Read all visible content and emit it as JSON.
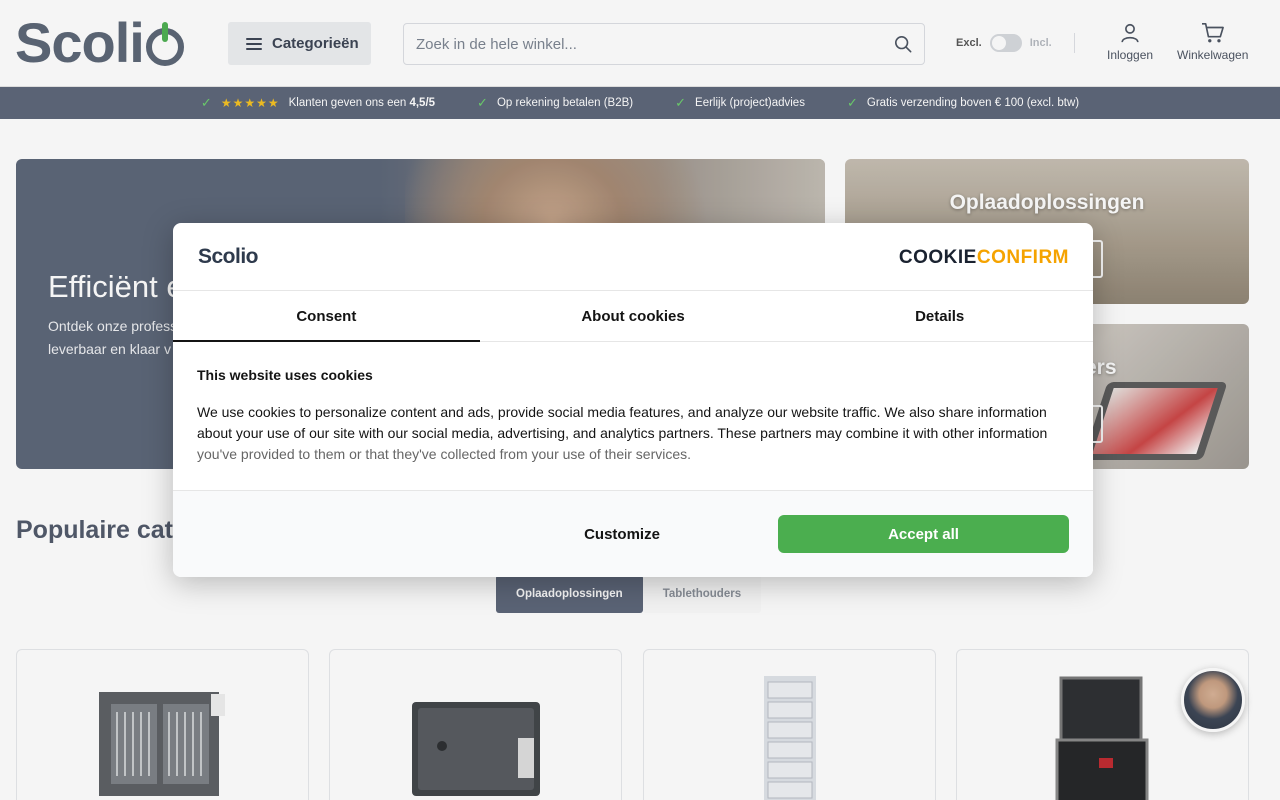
{
  "header": {
    "logo": "Scolio",
    "categories_label": "Categorieën",
    "search_placeholder": "Zoek in de hele winkel...",
    "vat_excl": "Excl.",
    "vat_incl": "Incl.",
    "login_label": "Inloggen",
    "cart_label": "Winkelwagen"
  },
  "usp": {
    "rating_stars": "★★★★★",
    "rating_text": "Klanten geven ons een",
    "rating_value": "4,5/5",
    "item2": "Op rekening betalen (B2B)",
    "item3": "Eerlijk (project)advies",
    "item4": "Gratis verzending boven € 100 (excl. btw)"
  },
  "hero": {
    "title": "Efficiënt e",
    "subtitle_line1": "Ontdek onze profess",
    "subtitle_line2": "leverbaar en klaar v",
    "side_top_title": "Oplaadoplossingen",
    "side_bottom_title": "ers"
  },
  "popular": {
    "heading": "Populaire cate",
    "tabs": [
      "Oplaadoplossingen",
      "Tablethouders"
    ]
  },
  "cookie": {
    "logo": "Scolio",
    "brand_part1": "COOKIE",
    "brand_part2": "CONFIRM",
    "tabs": [
      "Consent",
      "About cookies",
      "Details"
    ],
    "title": "This website uses cookies",
    "body_main": "We use cookies to personalize content and ads, provide social media features, and analyze our website traffic. We also share information about your use of our site with our social media, advertising, and analytics partners. These partners may combine it with other information",
    "body_fade": "you've provided to them or that they've collected from your use of their services.",
    "customize_label": "Customize",
    "accept_label": "Accept all"
  },
  "colors": {
    "brand_slate": "#5b6478",
    "accent_green": "#4bae4f",
    "cookie_orange": "#f5a300"
  }
}
